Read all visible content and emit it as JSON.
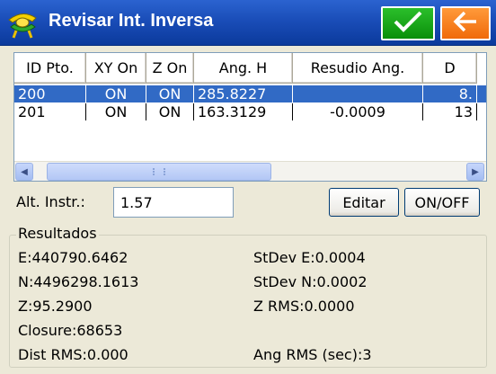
{
  "window": {
    "title": "Revisar Int. Inversa",
    "app_icon": "survey-instrument-icon",
    "ok_icon": "checkmark-icon",
    "back_icon": "arrow-left-icon",
    "titlebar_color": "#1a4db8",
    "ok_color": "#0a8f0a",
    "back_color": "#f07a10"
  },
  "table": {
    "headers": [
      "ID Pto.",
      "XY On",
      "Z On",
      "Ang. H",
      "Resudio Ang.",
      "D"
    ],
    "rows": [
      {
        "id": "200",
        "xy": "ON",
        "z": "ON",
        "ang": "285.8227",
        "res": "",
        "d": "8."
      },
      {
        "id": "201",
        "xy": "ON",
        "z": "ON",
        "ang": "163.3129",
        "res": "-0.0009",
        "d": "13"
      }
    ],
    "selected_row": 0,
    "selection_color": "#316ac5"
  },
  "instrument": {
    "label": "Alt. Instr.:",
    "value": "1.57",
    "edit_label": "Editar",
    "onoff_label": "ON/OFF"
  },
  "results": {
    "title": "Resultados",
    "e": "E:440790.6462",
    "n": "N:4496298.1613",
    "z": "Z:95.2900",
    "closure": "Closure:68653",
    "dist_rms": "Dist RMS:0.000",
    "stdev_e": "StDev E:0.0004",
    "stdev_n": "StDev N:0.0002",
    "z_rms": "Z RMS:0.0000",
    "ang_rms": "Ang RMS (sec):3"
  }
}
